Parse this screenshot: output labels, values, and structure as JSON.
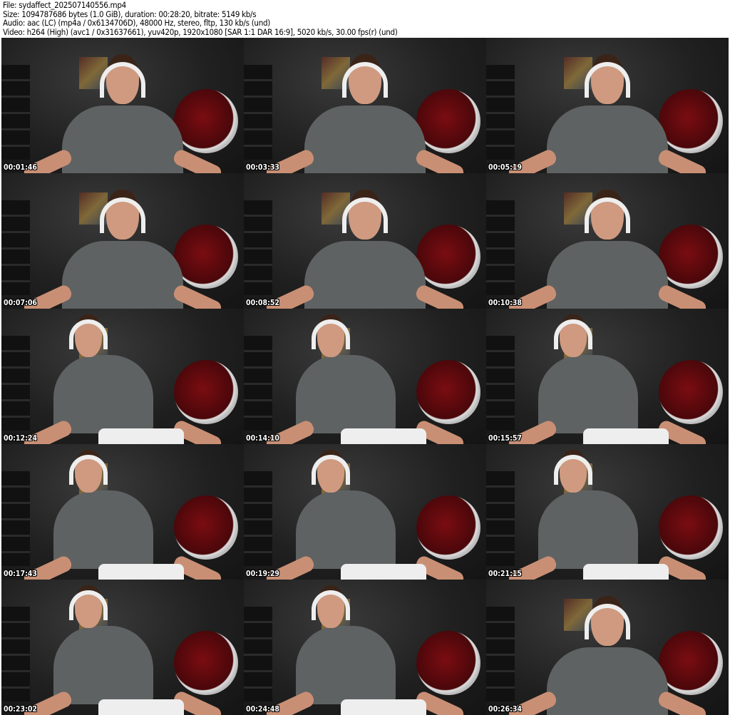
{
  "header": {
    "file": "File: sydaffect_202507140556.mp4",
    "size": "Size: 1094787686 bytes (1.0 GiB), duration: 00:28:20, bitrate: 5149 kb/s",
    "audio": "Audio: aac (LC) (mp4a / 0x6134706D), 48000 Hz, stereo, fltp, 130 kb/s (und)",
    "video": "Video: h264 (High) (avc1 / 0x31637661), yuv420p, 1920x1080 [SAR 1:1 DAR 16:9], 5020 kb/s, 30.00 fps(r) (und)"
  },
  "thumbnails": [
    {
      "timestamp": "00:01:46"
    },
    {
      "timestamp": "00:03:33"
    },
    {
      "timestamp": "00:05:19"
    },
    {
      "timestamp": "00:07:06"
    },
    {
      "timestamp": "00:08:52"
    },
    {
      "timestamp": "00:10:38"
    },
    {
      "timestamp": "00:12:24"
    },
    {
      "timestamp": "00:14:10"
    },
    {
      "timestamp": "00:15:57"
    },
    {
      "timestamp": "00:17:43"
    },
    {
      "timestamp": "00:19:29"
    },
    {
      "timestamp": "00:21:15"
    },
    {
      "timestamp": "00:23:02"
    },
    {
      "timestamp": "00:24:48"
    },
    {
      "timestamp": "00:26:34"
    }
  ]
}
